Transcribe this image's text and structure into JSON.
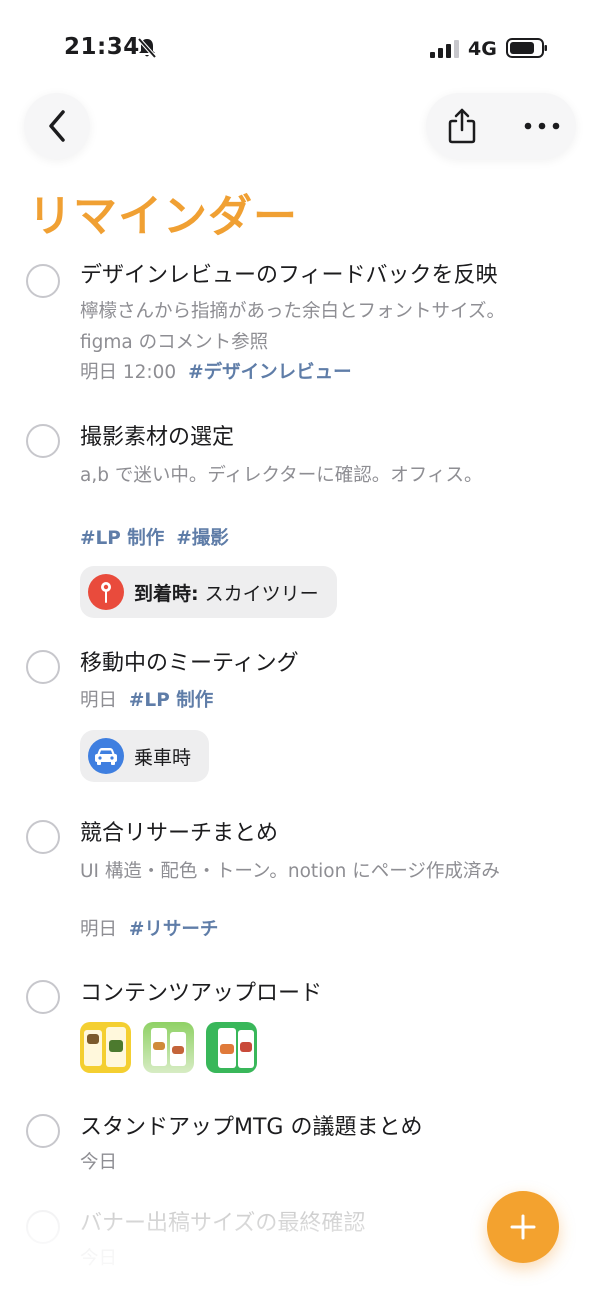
{
  "status_bar": {
    "time": "21:34",
    "network": "4G"
  },
  "header": {
    "title": "リマインダー"
  },
  "items": [
    {
      "title": "デザインレビューのフィードバックを反映",
      "note_line1": "檸檬さんから指摘があった余白とフォントサイズ。",
      "note_line2": "figma のコメント参照",
      "date": "明日 12:00",
      "tag1": "#デザインレビュー"
    },
    {
      "title": "撮影素材の選定",
      "note": "a,b で迷い中。ディレクターに確認。オフィス。",
      "tag1": "#LP 制作",
      "tag2": "#撮影",
      "chip_bold": "到着時:",
      "chip_text": "スカイツリー"
    },
    {
      "title": "移動中のミーティング",
      "date": "明日",
      "tag1": "#LP 制作",
      "chip_text": "乗車時"
    },
    {
      "title": "競合リサーチまとめ",
      "note": "UI 構造・配色・トーン。notion にページ作成済み",
      "date": "明日",
      "tag1": "#リサーチ"
    },
    {
      "title": "コンテンツアップロード"
    },
    {
      "title": "スタンドアップMTG の議題まとめ",
      "date": "今日"
    },
    {
      "title": "バナー出稿サイズの最終確認",
      "date": "今日"
    }
  ],
  "colors": {
    "accent": "#f0a033",
    "tag": "#5f7da8",
    "fab": "#f3a22f"
  },
  "icons": {
    "back": "chevron-left-icon",
    "share": "share-icon",
    "more": "ellipsis-icon",
    "location": "map-pin-icon",
    "car": "car-icon",
    "add": "plus-icon"
  }
}
